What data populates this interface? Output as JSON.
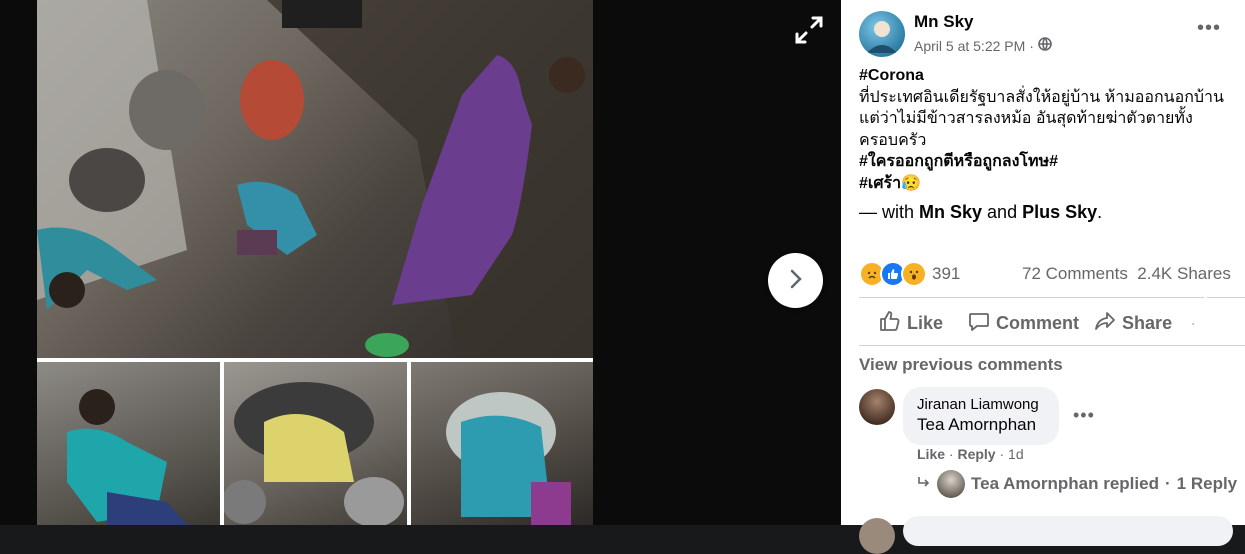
{
  "viewer": {
    "expand_icon": "expand-icon",
    "next_icon": "chevron-right-icon"
  },
  "post": {
    "author": "Mn Sky",
    "timestamp": "April 5 at 5:22 PM",
    "separator": "·",
    "audience_icon": "globe-icon",
    "more_label": "•••",
    "lines": [
      {
        "text": "#Corona",
        "tag": true
      },
      {
        "text": "ที่ประเทศอินเดียรัฐบาลสั่งให้อยู่บ้าน ห้ามออกนอกบ้าน แต่ว่าไม่มีข้าวสารลงหม้อ อันสุดท้ายฆ่าตัวตายทั้งครอบครัว",
        "tag": false
      },
      {
        "text": "#ใครออกถูกตีหรือถูกลงโทษ#",
        "tag": true
      },
      {
        "text": "#เศร้า😥",
        "tag": true
      }
    ],
    "with_prefix": "— with ",
    "with_person1": "Mn Sky",
    "with_and": " and ",
    "with_person2": "Plus Sky",
    "with_suffix": "."
  },
  "stats": {
    "reaction_icons": [
      "sad-reaction-icon",
      "like-reaction-icon",
      "wow-reaction-icon"
    ],
    "reaction_count": "391",
    "comments": "72 Comments",
    "shares": "2.4K Shares"
  },
  "actions": {
    "like": "Like",
    "comment": "Comment",
    "share": "Share",
    "extra": "·"
  },
  "comments": {
    "view_previous": "View previous comments",
    "items": [
      {
        "author": "Jiranan Liamwong",
        "text": "Tea Amornphan",
        "like": "Like",
        "reply": "Reply",
        "sep": "·",
        "age": "1d",
        "replied_text": "Tea Amornphan replied",
        "reply_count": "1 Reply"
      }
    ]
  },
  "colors": {
    "viewer_bg": "#0b0b0c",
    "panel_bg": "#ffffff",
    "secondary_text": "#65676b",
    "bubble_bg": "#f0f2f5",
    "like_blue": "#1877f2"
  }
}
